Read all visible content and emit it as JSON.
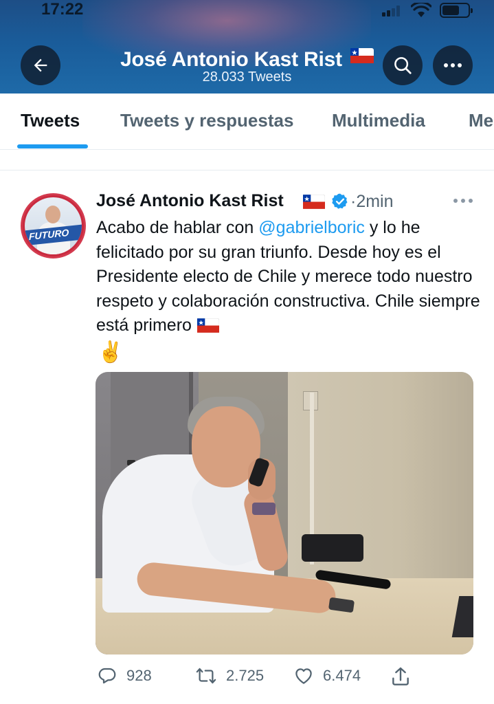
{
  "status_bar": {
    "time": "17:22"
  },
  "header": {
    "title": "José Antonio Kast Rist",
    "tweet_count": "28.033 Tweets",
    "colors": {
      "banner": "#1a5c9a",
      "button_bg": "#0f1928"
    }
  },
  "tabs": [
    {
      "label": "Tweets",
      "active": true
    },
    {
      "label": "Tweets y respuestas",
      "active": false
    },
    {
      "label": "Multimedia",
      "active": false
    },
    {
      "label": "Me",
      "active": false
    }
  ],
  "tweet": {
    "author_name": "José Antonio Kast Rist",
    "time": "2min",
    "avatar_text": "FUTURO",
    "text_before_mention": "Acabo de hablar con ",
    "mention": "@gabrielboric",
    "text_after_mention": " y lo he felicitado por su gran triunfo. Desde hoy es el Presidente electo de Chile y merece todo nuestro respeto y colaboración constructiva. Chile siempre está primero",
    "emoji_end": "✌️",
    "stats": {
      "replies": "928",
      "retweets": "2.725",
      "likes": "6.474"
    }
  },
  "colors": {
    "accent": "#1d9bf0",
    "text_secondary": "#536471",
    "verified": "#1d9bf0"
  }
}
